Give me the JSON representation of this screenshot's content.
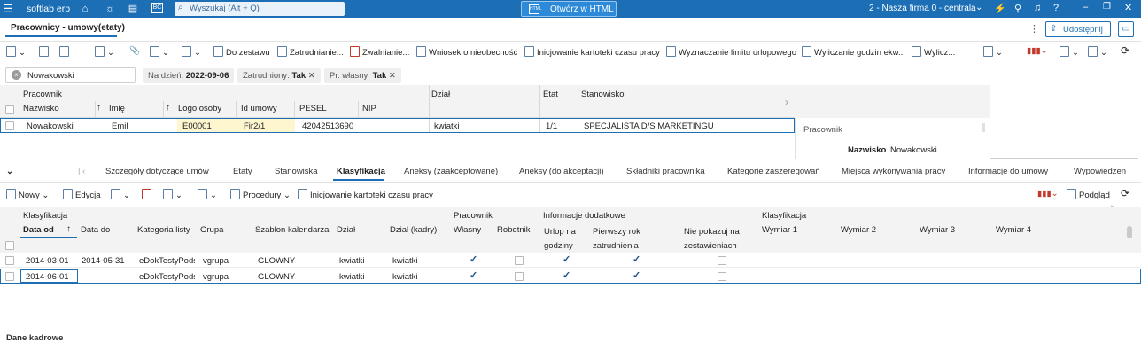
{
  "app": {
    "name": "softlab erp",
    "search_placeholder": "Wyszukaj (Alt + Q)",
    "html_button": "Otwórz w HTML",
    "company": "2 - Nasza firma 0 - centrala"
  },
  "tab": {
    "title": "Pracownicy - umowy(etaty)",
    "share": "Udostępnij"
  },
  "toolbar": {
    "items": [
      "Do zestawu",
      "Zatrudnianie...",
      "Zwalnianie...",
      "Wniosek o nieobecność",
      "Inicjowanie kartoteki czasu pracy",
      "Wyznaczanie limitu urlopowego",
      "Wyliczanie godzin ekw...",
      "Wylicz..."
    ]
  },
  "filters": {
    "search_value": "Nowakowski",
    "chips": [
      {
        "label": "Na dzień:",
        "value": "2022-09-06"
      },
      {
        "label": "Zatrudniony:",
        "value": "Tak"
      },
      {
        "label": "Pr. własny:",
        "value": "Tak"
      }
    ]
  },
  "grid1": {
    "group_header": "Pracownik",
    "columns": [
      "Nazwisko",
      "Imię",
      "Logo osoby",
      "Id umowy",
      "PESEL",
      "NIP"
    ],
    "extra_columns": [
      "Dział",
      "Etat",
      "Stanowisko"
    ],
    "row": {
      "nazwisko": "Nowakowski",
      "imie": "Emil",
      "logo": "E00001",
      "id_umowy": "Fir2/1",
      "pesel": "42042513690",
      "nip": "",
      "dzial": "kwiatki",
      "etat": "1/1",
      "stanowisko": "SPECJALISTA D/S MARKETINGU"
    }
  },
  "side_panel": {
    "title": "Pracownik",
    "label": "Nazwisko",
    "value": "Nowakowski"
  },
  "detail_tabs": {
    "dropdown": "Dane kadrowe",
    "items": [
      "Szczegóły dotyczące umów",
      "Etaty",
      "Stanowiska",
      "Klasyfikacja",
      "Aneksy (zaakceptowane)",
      "Aneksy (do akceptacji)",
      "Składniki pracownika",
      "Kategorie zaszeregowań",
      "Miejsca wykonywania pracy",
      "Informacje do umowy",
      "Wypowiedzen"
    ],
    "active": "Klasyfikacja"
  },
  "toolbar2": {
    "new": "Nowy",
    "edit": "Edycja",
    "procedures": "Procedury",
    "init": "Inicjowanie kartoteki czasu pracy",
    "preview": "Podgląd"
  },
  "grid2": {
    "groups": [
      "Klasyfikacja",
      "Pracownik",
      "Informacje dodatkowe",
      "Klasyfikacja"
    ],
    "columns": [
      "Data od",
      "Data do",
      "Kategoria listy",
      "Grupa",
      "Szablon kalendarza",
      "Dział",
      "Dział (kadry)",
      "Własny",
      "Robotnik",
      "Urlop na godziny",
      "Pierwszy rok zatrudnienia",
      "Nie pokazuj na zestawieniach",
      "Wymiar 1",
      "Wymiar 2",
      "Wymiar 3",
      "Wymiar 4"
    ],
    "rows": [
      {
        "data_od": "2014-03-01",
        "data_do": "2014-05-31",
        "kategoria": "eDokTestyPods",
        "grupa": "vgrupa",
        "szablon": "GLOWNY",
        "dzial": "kwiatki",
        "dzial_kadry": "kwiatki",
        "wlasny": true,
        "robotnik": false,
        "urlop": true,
        "pierwszy": true,
        "nie_pokazuj": false
      },
      {
        "data_od": "2014-06-01",
        "data_do": "",
        "kategoria": "eDokTestyPods",
        "grupa": "vgrupa",
        "szablon": "GLOWNY",
        "dzial": "kwiatki",
        "dzial_kadry": "kwiatki",
        "wlasny": true,
        "robotnik": false,
        "urlop": true,
        "pierwszy": true,
        "nie_pokazuj": false
      }
    ]
  }
}
